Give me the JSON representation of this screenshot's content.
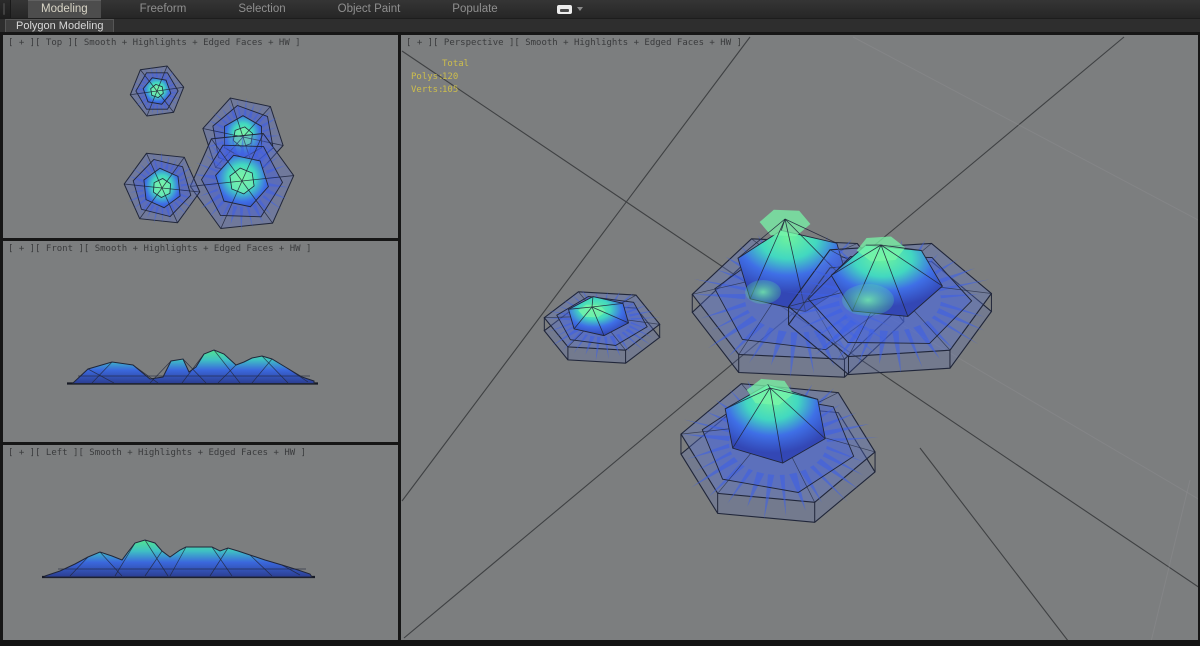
{
  "ribbon": {
    "tabs": [
      {
        "label": "Modeling",
        "active": true
      },
      {
        "label": "Freeform",
        "active": false
      },
      {
        "label": "Selection",
        "active": false
      },
      {
        "label": "Object Paint",
        "active": false
      },
      {
        "label": "Populate",
        "active": false
      }
    ],
    "minimize_icon": "ribbon-minimize",
    "panel_tab": "Polygon Modeling"
  },
  "viewports": {
    "top": {
      "name": "Top",
      "shading": "Smooth + Highlights + Edged Faces + HW",
      "label": "[ + ][ Top ][ Smooth + Highlights + Edged Faces + HW ]"
    },
    "front": {
      "name": "Front",
      "shading": "Smooth + Highlights + Edged Faces + HW",
      "label": "[ + ][ Front ][ Smooth + Highlights + Edged Faces + HW ]"
    },
    "left": {
      "name": "Left",
      "shading": "Smooth + Highlights + Edged Faces + HW",
      "label": "[ + ][ Left ][ Smooth + Highlights + Edged Faces + HW ]"
    },
    "perspective": {
      "name": "Perspective",
      "shading": "Smooth + Highlights + Edged Faces + HW",
      "label": "[ + ][ Perspective ][ Smooth + Highlights + Edged Faces + HW ]",
      "stats": {
        "header": "Total",
        "rows": [
          {
            "label": "Polys:",
            "value": "120"
          },
          {
            "label": "Verts:",
            "value": "105"
          }
        ]
      }
    }
  },
  "colors": {
    "viewport_bg": "#7c7e7f",
    "wire": "#20263a",
    "mesh_green": "#58ea92",
    "mesh_blue": "#3a5fd8",
    "grid_line": "#3f4143",
    "grid_line_faint": "#909294",
    "stats_text": "#cdbe4c",
    "label_text": "#3a3b3d",
    "active_tab_bg": "#4d4d4d"
  }
}
